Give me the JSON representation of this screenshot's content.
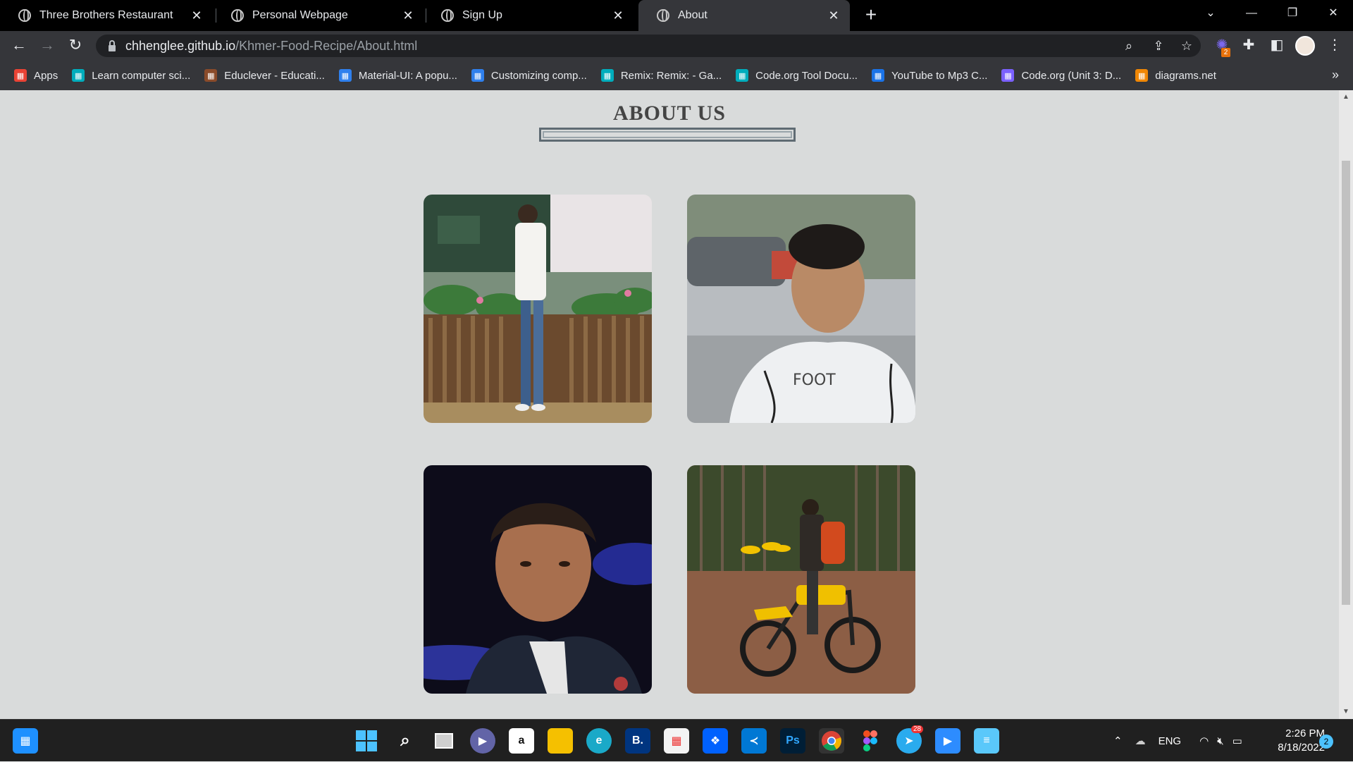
{
  "tabs": [
    {
      "label": "Three Brothers Restaurant"
    },
    {
      "label": "Personal Webpage"
    },
    {
      "label": "Sign Up"
    },
    {
      "label": "About"
    }
  ],
  "address": {
    "host": "chhenglee.github.io",
    "path": "/Khmer-Food-Recipe/About.html"
  },
  "extension_badge": "2",
  "bookmarks": [
    {
      "label": "Apps",
      "icon": "apps-grid-icon",
      "color": "#ea4335"
    },
    {
      "label": "Learn computer sci...",
      "icon": "code-org-icon",
      "color": "#00adbc"
    },
    {
      "label": "Educlever - Educati...",
      "icon": "educlever-icon",
      "color": "#8a4b2a"
    },
    {
      "label": "Material-UI: A popu...",
      "icon": "mui-icon",
      "color": "#2f80ed"
    },
    {
      "label": "Customizing comp...",
      "icon": "mui-icon",
      "color": "#2f80ed"
    },
    {
      "label": "Remix: Remix: - Ga...",
      "icon": "code-org-icon",
      "color": "#00adbc"
    },
    {
      "label": "Code.org Tool Docu...",
      "icon": "code-org-icon",
      "color": "#00adbc"
    },
    {
      "label": "YouTube to Mp3 C...",
      "icon": "download-cloud-icon",
      "color": "#1a73e8"
    },
    {
      "label": "Code.org (Unit 3: D...",
      "icon": "q-icon",
      "color": "#7b61ff"
    },
    {
      "label": "diagrams.net",
      "icon": "diagrams-icon",
      "color": "#f08705"
    }
  ],
  "page": {
    "title": "ABOUT US",
    "photos": [
      {
        "alt": "Person in white shirt leaning on wooden fence with plants"
      },
      {
        "alt": "Person in white long-sleeve shirt on street"
      },
      {
        "alt": "Person in dark jacket at night with blue lights"
      },
      {
        "alt": "Person on yellow dirt bike in forest"
      }
    ]
  },
  "taskbar": {
    "apps": [
      "windows-start-icon",
      "search-icon",
      "task-view-icon",
      "teams-chat-icon",
      "amazon-icon",
      "file-explorer-icon",
      "edge-icon",
      "booking-icon",
      "store-icon",
      "dropbox-icon",
      "vscode-icon",
      "photoshop-icon",
      "chrome-icon",
      "figma-icon",
      "telegram-icon",
      "zoom-icon",
      "notepad-icon"
    ],
    "telegram_badge": "28",
    "language": "ENG",
    "time": "2:26 PM",
    "date": "8/18/2022",
    "notifications": "2"
  }
}
